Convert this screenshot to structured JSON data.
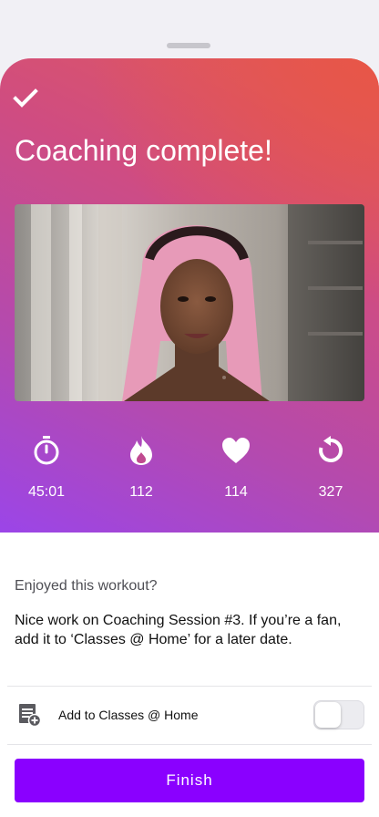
{
  "header": {
    "title": "Coaching complete!",
    "check_icon": "checkmark-icon"
  },
  "photo": {
    "description_icon": "instructor-photo"
  },
  "stats": [
    {
      "icon": "stopwatch-icon",
      "value": "45:01"
    },
    {
      "icon": "flame-icon",
      "value": "112"
    },
    {
      "icon": "heart-icon",
      "value": "114"
    },
    {
      "icon": "replay-icon",
      "value": "327"
    }
  ],
  "feedback": {
    "question": "Enjoyed this workout?",
    "message": "Nice work on Coaching Session #3. If you’re a fan, add it to ‘Classes @ Home’ for a later date."
  },
  "add_row": {
    "icon": "add-to-list-icon",
    "label": "Add to Classes @ Home",
    "toggle_on": false
  },
  "actions": {
    "finish_label": "Finish"
  },
  "colors": {
    "accent": "#8a00ff",
    "gradient_top": "#e25a58",
    "gradient_bottom": "#9b45e8"
  }
}
